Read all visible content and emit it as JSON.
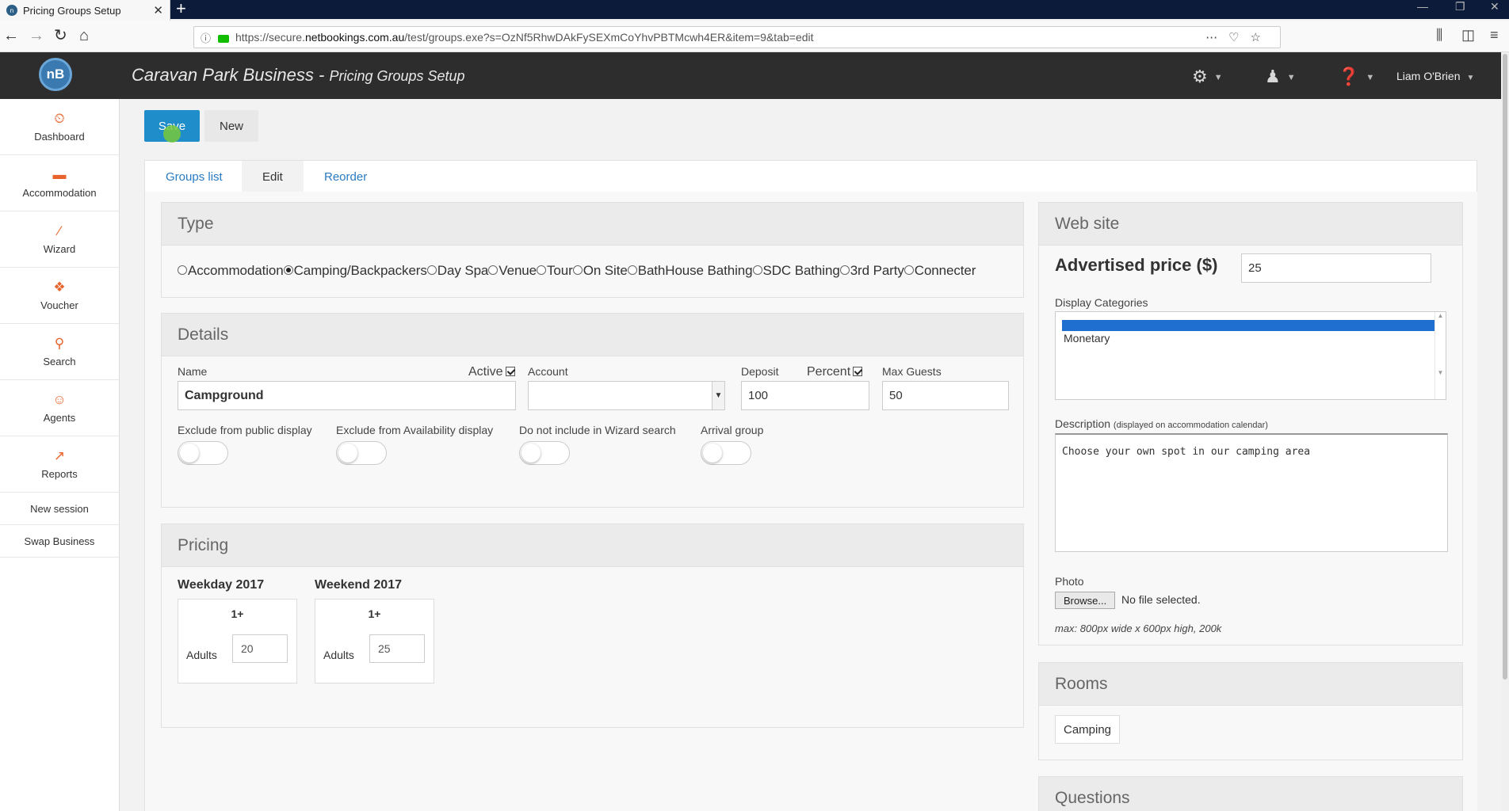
{
  "browser": {
    "tab_title": "Pricing Groups Setup",
    "url_prefix": "https://secure.",
    "url_domain": "netbookings.com.au",
    "url_rest": "/test/groups.exe?s=OzNf5RhwDAkFySEXmCoYhvPBTMcwh4ER&item=9&tab=edit"
  },
  "header": {
    "logo": "nB",
    "title": "Caravan Park Business",
    "separator": " - ",
    "subtitle": "Pricing Groups Setup",
    "user": "Liam O'Brien"
  },
  "sidebar": {
    "items": [
      {
        "label": "Dashboard",
        "icon": "dashboard-icon",
        "glyph": "⏲"
      },
      {
        "label": "Accommodation",
        "icon": "bed-icon",
        "glyph": "▬"
      },
      {
        "label": "Wizard",
        "icon": "magic-wand-icon",
        "glyph": "⁄"
      },
      {
        "label": "Voucher",
        "icon": "gift-icon",
        "glyph": "❖"
      },
      {
        "label": "Search",
        "icon": "search-icon",
        "glyph": "⚲"
      },
      {
        "label": "Agents",
        "icon": "agent-icon",
        "glyph": "☺"
      },
      {
        "label": "Reports",
        "icon": "chart-icon",
        "glyph": "↗"
      }
    ],
    "new_session": "New session",
    "swap_business": "Swap Business"
  },
  "toolbar": {
    "save": "Save",
    "new": "New"
  },
  "tabs": [
    "Groups list",
    "Edit",
    "Reorder"
  ],
  "type_panel": {
    "title": "Type",
    "options": [
      {
        "label": "Accommodation",
        "selected": false
      },
      {
        "label": "Camping/Backpackers",
        "selected": true
      },
      {
        "label": "Day Spa",
        "selected": false
      },
      {
        "label": "Venue",
        "selected": false
      },
      {
        "label": "Tour",
        "selected": false
      },
      {
        "label": "On Site",
        "selected": false
      },
      {
        "label": "BathHouse Bathing",
        "selected": false
      },
      {
        "label": "SDC Bathing",
        "selected": false
      },
      {
        "label": "3rd Party",
        "selected": false
      },
      {
        "label": "Connecter",
        "selected": false
      }
    ]
  },
  "details": {
    "title": "Details",
    "name_label": "Name",
    "name_value": "Campground",
    "active_label": "Active",
    "active_checked": true,
    "account_label": "Account",
    "account_value": "",
    "deposit_label": "Deposit",
    "deposit_value": "100",
    "percent_label": "Percent",
    "percent_checked": true,
    "max_guests_label": "Max Guests",
    "max_guests_value": "50",
    "toggles": [
      {
        "label": "Exclude from public display",
        "on": false
      },
      {
        "label": "Exclude from Availability display",
        "on": false
      },
      {
        "label": "Do not include in Wizard search",
        "on": false
      },
      {
        "label": "Arrival group",
        "on": false
      }
    ]
  },
  "pricing": {
    "title": "Pricing",
    "groups": [
      {
        "name": "Weekday 2017",
        "range": "1+",
        "row_label": "Adults",
        "value": "20"
      },
      {
        "name": "Weekend 2017",
        "range": "1+",
        "row_label": "Adults",
        "value": "25"
      }
    ]
  },
  "website": {
    "title": "Web site",
    "advertised_label": "Advertised price ($)",
    "advertised_value": "25",
    "categories_label": "Display Categories",
    "categories": [
      "Monetary"
    ],
    "description_label": "Description",
    "description_hint": "(displayed on accommodation calendar)",
    "description_value": "Choose your own spot in our camping area",
    "photo_label": "Photo",
    "browse_label": "Browse...",
    "no_file": "No file selected.",
    "photo_note": "max: 800px wide x 600px high, 200k"
  },
  "rooms": {
    "title": "Rooms",
    "items": [
      "Camping"
    ]
  },
  "questions": {
    "title": "Questions"
  },
  "colors": {
    "save": "#1f8dc9",
    "header": "#2d2d2d",
    "accent": "#e8642c",
    "link": "#2a7bc2"
  }
}
